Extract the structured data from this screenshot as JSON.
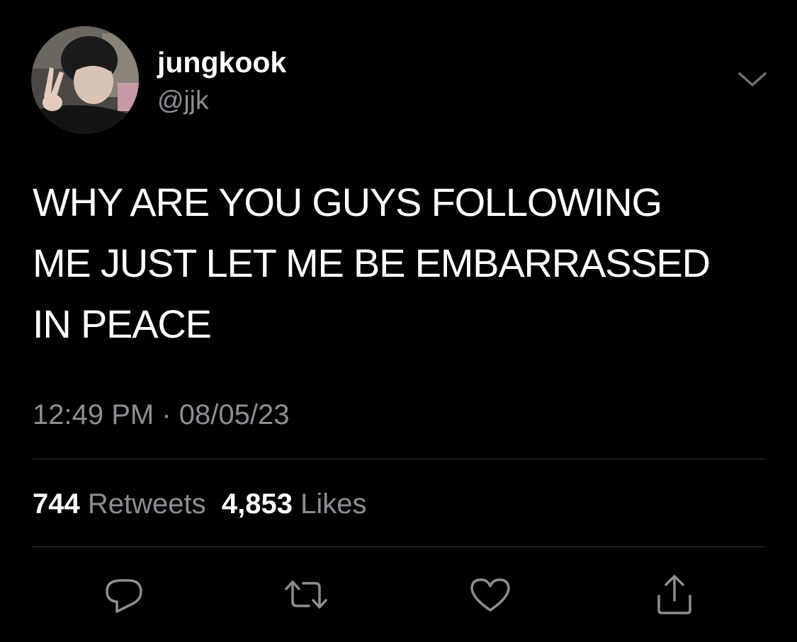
{
  "user": {
    "display_name": "jungkook",
    "handle": "@jjk"
  },
  "tweet": {
    "text": "WHY ARE YOU GUYS FOLLOWING\nME JUST LET ME BE EMBARRASSED\nIN PEACE",
    "time": "12:49 PM",
    "separator": "·",
    "date": "08/05/23"
  },
  "stats": {
    "retweets_count": "744",
    "retweets_label": "Retweets",
    "likes_count": "4,853",
    "likes_label": "Likes"
  },
  "actions": {
    "reply_icon": "reply-icon",
    "retweet_icon": "retweet-icon",
    "like_icon": "heart-icon",
    "share_icon": "share-icon"
  },
  "colors": {
    "background": "#000000",
    "text_primary": "#ffffff",
    "text_secondary": "#8b8f94",
    "divider": "#2f3336"
  }
}
